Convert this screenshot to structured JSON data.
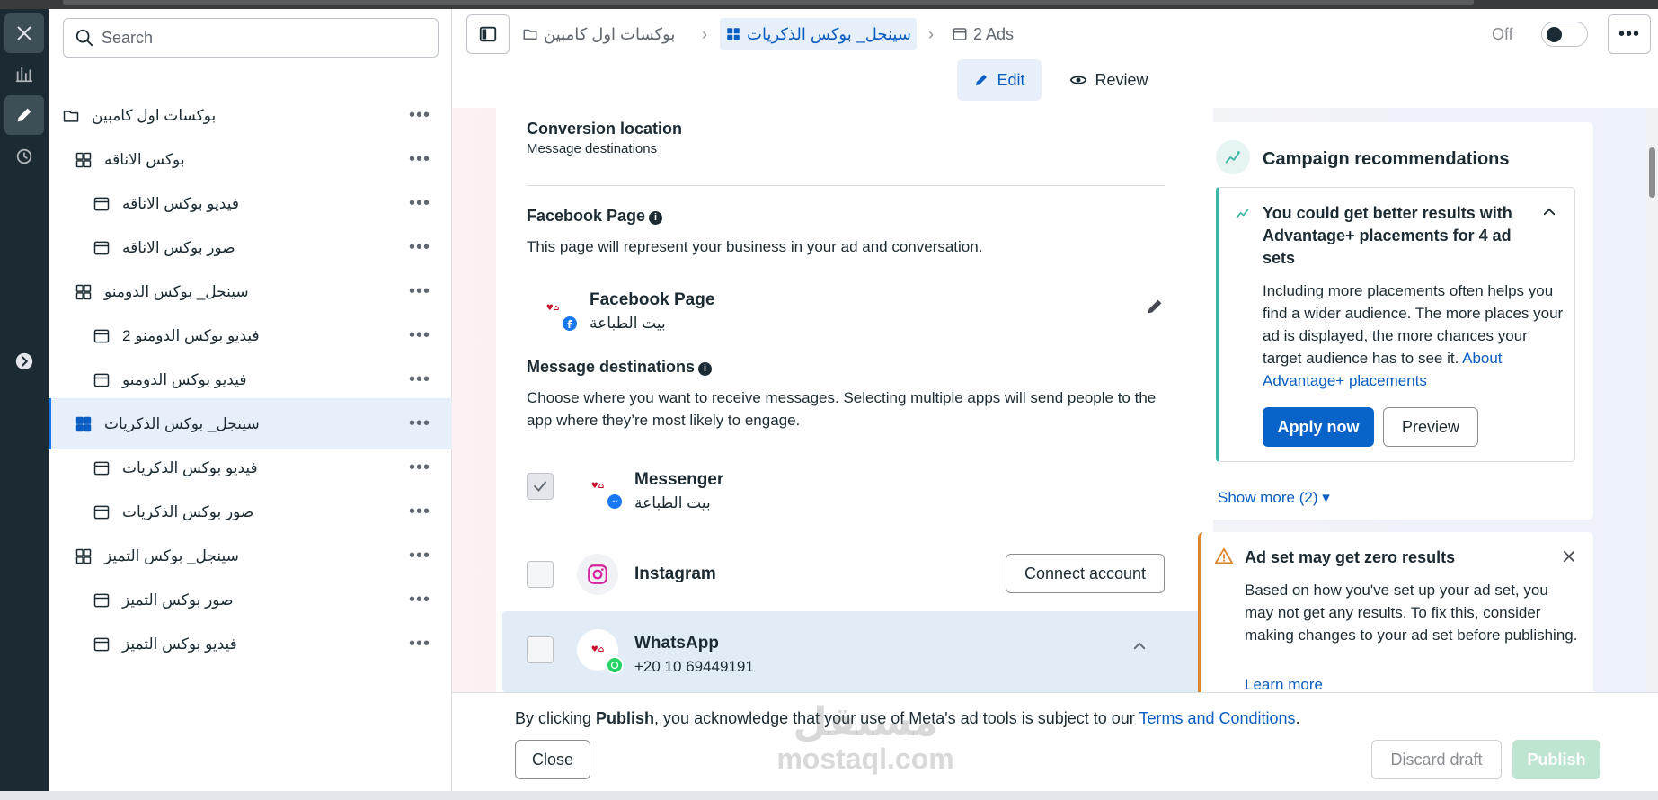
{
  "sidebar": {
    "search_placeholder": "Search",
    "items": [
      {
        "label": "بوكسات اول كامبين",
        "type": "campaign"
      },
      {
        "label": "بوكس الاناقه",
        "type": "adset"
      },
      {
        "label": "فيديو بوكس الاناقه",
        "type": "ad"
      },
      {
        "label": "صور بوكس الاناقه",
        "type": "ad"
      },
      {
        "label": "سينجل_ بوكس الدومنو",
        "type": "adset"
      },
      {
        "label": "2 فيديو بوكس الدومنو",
        "type": "ad"
      },
      {
        "label": "فيديو بوكس الدومنو",
        "type": "ad"
      },
      {
        "label": "سينجل_ بوكس الذكريات",
        "type": "adset",
        "selected": true
      },
      {
        "label": "فيديو بوكس الذكريات",
        "type": "ad"
      },
      {
        "label": "صور بوكس الذكريات",
        "type": "ad"
      },
      {
        "label": "سينجل_ بوكس التميز",
        "type": "adset"
      },
      {
        "label": "صور بوكس التميز",
        "type": "ad"
      },
      {
        "label": "فيديو بوكس التميز",
        "type": "ad"
      }
    ],
    "more_glyph": "•••"
  },
  "header": {
    "breadcrumbs": [
      "بوكسات اول كامبين",
      "سينجل_ بوكس الذكريات",
      "2 Ads"
    ],
    "toggle_label": "Off",
    "toggle_on": false,
    "more_glyph": "•••",
    "edit_label": "Edit",
    "review_label": "Review"
  },
  "form": {
    "conversion_title": "Conversion location",
    "conversion_value": "Message destinations",
    "page_section_title": "Facebook Page",
    "page_section_desc": "This page will represent your business in your ad and conversation.",
    "page_card_title": "Facebook Page",
    "page_card_name": "بيت الطباعة",
    "dest_title": "Message destinations",
    "dest_desc": "Choose where you want to receive messages. Selecting multiple apps will send people to the app where they’re most likely to engage.",
    "info_glyph": "i",
    "destinations": [
      {
        "name": "Messenger",
        "detail": "بيت الطباعة",
        "checked": true
      },
      {
        "name": "Instagram",
        "detail": "",
        "checked": false,
        "action": "Connect account"
      },
      {
        "name": "WhatsApp",
        "detail": "+20 10 69449191",
        "checked": false
      }
    ]
  },
  "recommendations": {
    "title": "Campaign recommendations",
    "item_title": "You could get better results with Advantage+ placements for 4 ad sets",
    "item_body": "Including more placements often helps you find a wider audience. The more places your ad is displayed, the more chances your target audience has to see it.",
    "item_link": "About Advantage+ placements",
    "apply_label": "Apply now",
    "preview_label": "Preview",
    "show_more": "Show more (2)"
  },
  "warning": {
    "title": "Ad set may get zero results",
    "body": "Based on how you've set up your ad set, you may not get any results. To fix this, consider making changes to your ad set before publishing.",
    "link": "Learn more"
  },
  "footer": {
    "legal_prefix": "By clicking ",
    "legal_bold": "Publish",
    "legal_mid": ", you acknowledge that your use of Meta's ad tools is subject to our ",
    "legal_link": "Terms and Conditions",
    "legal_end": ".",
    "close_label": "Close",
    "discard_label": "Discard draft",
    "publish_label": "Publish"
  },
  "watermark": {
    "line1": "مستقل",
    "line2": "mostaql.com"
  },
  "colors": {
    "accent": "#0a63c9",
    "rail": "#1c2b33",
    "selected_bg": "#e7f0fa",
    "warning": "#e0862a",
    "teal": "#3ab7a5"
  }
}
